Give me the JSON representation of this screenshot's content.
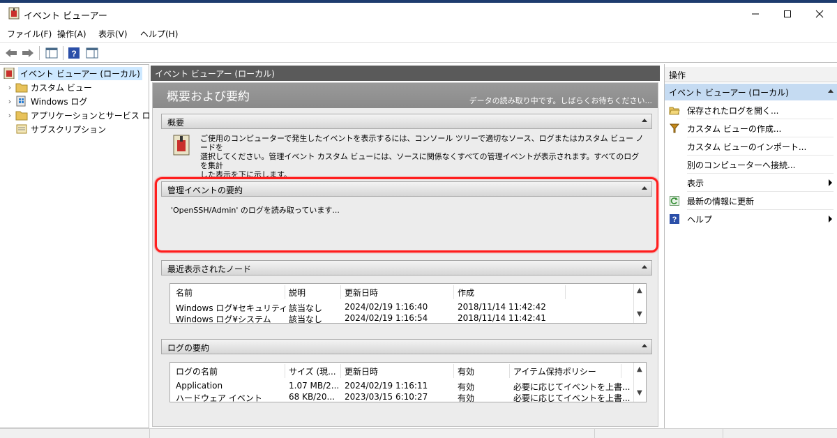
{
  "window": {
    "title": "イベント ビューアー"
  },
  "menu": [
    "ファイル(F)",
    "操作(A)",
    "表示(V)",
    "ヘルプ(H)"
  ],
  "tree": {
    "root": "イベント ビューアー (ローカル)",
    "items": [
      "カスタム ビュー",
      "Windows ログ",
      "アプリケーションとサービス ログ",
      "サブスクリプション"
    ]
  },
  "center": {
    "pane_title": "イベント ビューアー (ローカル)",
    "overview_title": "概要および要約",
    "loading_text": "データの読み取り中です。しばらくお待ちください...",
    "overview_section": {
      "title": "概要",
      "lines": [
        "ご使用のコンピューターで発生したイベントを表示するには、コンソール ツリーで適切なソース、ログまたはカスタム ビュー ノードを",
        "選択してください。管理イベント カスタム ビューには、ソースに関係なくすべての管理イベントが表示されます。すべてのログを集計",
        "した表示を下に示します。"
      ]
    },
    "admin_section": {
      "title": "管理イベントの要約",
      "reading": "'OpenSSH/Admin' のログを読み取っています..."
    },
    "recent_section": {
      "title": "最近表示されたノード",
      "columns": [
        "名前",
        "説明",
        "更新日時",
        "作成"
      ],
      "rows": [
        [
          "Windows ログ¥セキュリティ",
          "該当なし",
          "2024/02/19 1:16:40",
          "2018/11/14 11:42:42"
        ],
        [
          "Windows ログ¥システム",
          "該当なし",
          "2024/02/19 1:16:54",
          "2018/11/14 11:42:41"
        ]
      ]
    },
    "log_section": {
      "title": "ログの要約",
      "columns": [
        "ログの名前",
        "サイズ (現...",
        "更新日時",
        "有効",
        "アイテム保持ポリシー"
      ],
      "rows": [
        [
          "Application",
          "1.07 MB/2...",
          "2024/02/19 1:16:11",
          "有効",
          "必要に応じてイベントを上書..."
        ],
        [
          "ハードウェア イベント",
          "68 KB/20...",
          "2023/03/15 6:10:27",
          "有効",
          "必要に応じてイベントを上書..."
        ]
      ]
    }
  },
  "actions": {
    "header": "操作",
    "section": "イベント ビューアー (ローカル)",
    "items": [
      {
        "label": "保存されたログを開く...",
        "icon": "folder-open-icon"
      },
      {
        "label": "カスタム ビューの作成...",
        "icon": "filter-icon"
      },
      {
        "label": "カスタム ビューのインポート...",
        "icon": ""
      },
      {
        "label": "別のコンピューターへ接続...",
        "icon": ""
      },
      {
        "label": "表示",
        "icon": ""
      },
      {
        "label": "最新の情報に更新",
        "icon": "refresh-icon"
      },
      {
        "label": "ヘルプ",
        "icon": "help-icon"
      }
    ]
  },
  "colors": {
    "accent_highlight": "#ff1e1e",
    "selection": "#cde8ff",
    "action_section": "#c5dbf2",
    "pane_header": "#5a5a5a"
  }
}
